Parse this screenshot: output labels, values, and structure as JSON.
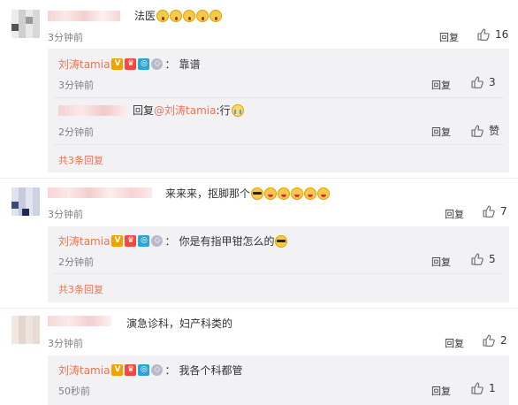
{
  "comments": [
    {
      "text": "法医",
      "time": "3分钟前",
      "reply_label": "回复",
      "likes": "16",
      "replies": [
        {
          "author": "刘涛tamia",
          "sep": "：",
          "text": "靠谱",
          "time": "3分钟前",
          "reply_label": "回复",
          "likes": "3"
        },
        {
          "prefix": "回复",
          "mention": "@刘涛tamia",
          "text": ":行",
          "time": "2分钟前",
          "reply_label": "回复",
          "likes": "赞"
        }
      ],
      "more_replies": "共3条回复"
    },
    {
      "text": "来来来，抠脚那个",
      "time": "3分钟前",
      "reply_label": "回复",
      "likes": "7",
      "replies": [
        {
          "author": "刘涛tamia",
          "sep": "：",
          "text": "你是有指甲钳怎么的",
          "time": "2分钟前",
          "reply_label": "回复",
          "likes": "5"
        }
      ],
      "more_replies": "共3条回复"
    },
    {
      "text": "演急诊科，妇产科类的",
      "time": "3分钟前",
      "reply_label": "回复",
      "likes": "2",
      "replies": [
        {
          "author": "刘涛tamia",
          "sep": "：",
          "text": "我各个科都管",
          "time": "50秒前",
          "reply_label": "回复",
          "likes": "1"
        }
      ]
    }
  ],
  "colors": {
    "accent": "#eb7350",
    "text": "#333333",
    "muted": "#808080",
    "reply_bg": "#f2f2f5"
  },
  "icons": [
    "thumbs-up-icon",
    "verified-v-icon",
    "emoji-icon"
  ]
}
